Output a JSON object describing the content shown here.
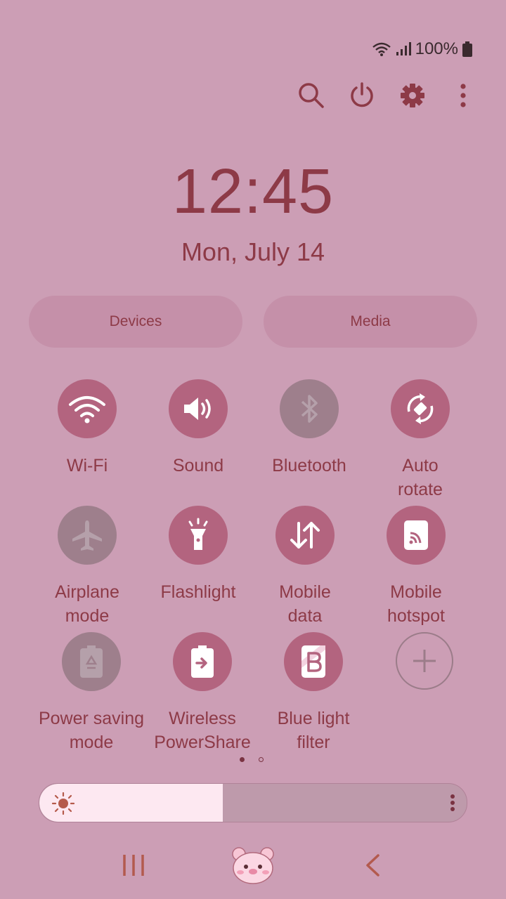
{
  "status": {
    "battery": "100%",
    "icons": [
      "wifi-icon",
      "signal-icon",
      "battery-icon"
    ]
  },
  "top_actions": [
    "search-icon",
    "power-icon",
    "settings-icon",
    "more-icon"
  ],
  "clock": {
    "time": "12:45",
    "date": "Mon, July 14"
  },
  "pills": {
    "devices": "Devices",
    "media": "Media"
  },
  "tiles": [
    {
      "label": "Wi-Fi",
      "icon": "wifi-icon",
      "state": "on"
    },
    {
      "label": "Sound",
      "icon": "sound-icon",
      "state": "on"
    },
    {
      "label": "Bluetooth",
      "icon": "bluetooth-icon",
      "state": "off"
    },
    {
      "label": "Auto\nrotate",
      "icon": "auto-rotate-icon",
      "state": "on"
    },
    {
      "label": "Airplane\nmode",
      "icon": "airplane-icon",
      "state": "off"
    },
    {
      "label": "Flashlight",
      "icon": "flashlight-icon",
      "state": "on"
    },
    {
      "label": "Mobile\ndata",
      "icon": "mobile-data-icon",
      "state": "on"
    },
    {
      "label": "Mobile\nhotspot",
      "icon": "hotspot-icon",
      "state": "on"
    },
    {
      "label": "Power saving\nmode",
      "icon": "power-saving-icon",
      "state": "off"
    },
    {
      "label": "Wireless\nPowerShare",
      "icon": "wireless-powershare-icon",
      "state": "on"
    },
    {
      "label": "Blue light\nfilter",
      "icon": "blue-light-filter-icon",
      "state": "on"
    },
    {
      "label": "",
      "icon": "add-icon",
      "state": "add"
    }
  ],
  "page_indicator": {
    "pages": 2,
    "current": 1
  },
  "brightness": {
    "level": 0.43
  },
  "nav": [
    "recent-apps-icon",
    "home-icon",
    "back-icon"
  ],
  "colors": {
    "background": "#cc9eb5",
    "accent": "#b3647f",
    "text": "#8d3a47"
  }
}
